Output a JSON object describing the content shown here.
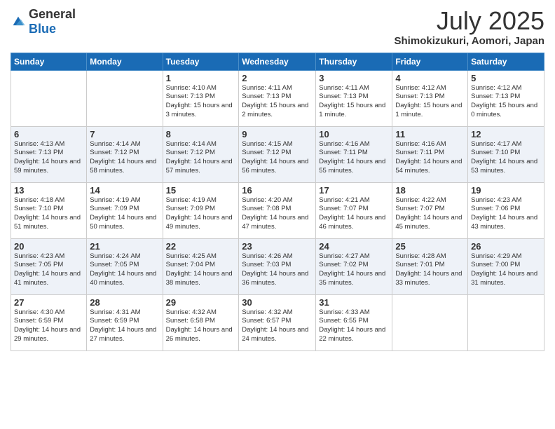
{
  "logo": {
    "general": "General",
    "blue": "Blue"
  },
  "title": "July 2025",
  "subtitle": "Shimokizukuri, Aomori, Japan",
  "weekdays": [
    "Sunday",
    "Monday",
    "Tuesday",
    "Wednesday",
    "Thursday",
    "Friday",
    "Saturday"
  ],
  "weeks": [
    [
      {
        "day": "",
        "sunrise": "",
        "sunset": "",
        "daylight": ""
      },
      {
        "day": "",
        "sunrise": "",
        "sunset": "",
        "daylight": ""
      },
      {
        "day": "1",
        "sunrise": "Sunrise: 4:10 AM",
        "sunset": "Sunset: 7:13 PM",
        "daylight": "Daylight: 15 hours and 3 minutes."
      },
      {
        "day": "2",
        "sunrise": "Sunrise: 4:11 AM",
        "sunset": "Sunset: 7:13 PM",
        "daylight": "Daylight: 15 hours and 2 minutes."
      },
      {
        "day": "3",
        "sunrise": "Sunrise: 4:11 AM",
        "sunset": "Sunset: 7:13 PM",
        "daylight": "Daylight: 15 hours and 1 minute."
      },
      {
        "day": "4",
        "sunrise": "Sunrise: 4:12 AM",
        "sunset": "Sunset: 7:13 PM",
        "daylight": "Daylight: 15 hours and 1 minute."
      },
      {
        "day": "5",
        "sunrise": "Sunrise: 4:12 AM",
        "sunset": "Sunset: 7:13 PM",
        "daylight": "Daylight: 15 hours and 0 minutes."
      }
    ],
    [
      {
        "day": "6",
        "sunrise": "Sunrise: 4:13 AM",
        "sunset": "Sunset: 7:13 PM",
        "daylight": "Daylight: 14 hours and 59 minutes."
      },
      {
        "day": "7",
        "sunrise": "Sunrise: 4:14 AM",
        "sunset": "Sunset: 7:12 PM",
        "daylight": "Daylight: 14 hours and 58 minutes."
      },
      {
        "day": "8",
        "sunrise": "Sunrise: 4:14 AM",
        "sunset": "Sunset: 7:12 PM",
        "daylight": "Daylight: 14 hours and 57 minutes."
      },
      {
        "day": "9",
        "sunrise": "Sunrise: 4:15 AM",
        "sunset": "Sunset: 7:12 PM",
        "daylight": "Daylight: 14 hours and 56 minutes."
      },
      {
        "day": "10",
        "sunrise": "Sunrise: 4:16 AM",
        "sunset": "Sunset: 7:11 PM",
        "daylight": "Daylight: 14 hours and 55 minutes."
      },
      {
        "day": "11",
        "sunrise": "Sunrise: 4:16 AM",
        "sunset": "Sunset: 7:11 PM",
        "daylight": "Daylight: 14 hours and 54 minutes."
      },
      {
        "day": "12",
        "sunrise": "Sunrise: 4:17 AM",
        "sunset": "Sunset: 7:10 PM",
        "daylight": "Daylight: 14 hours and 53 minutes."
      }
    ],
    [
      {
        "day": "13",
        "sunrise": "Sunrise: 4:18 AM",
        "sunset": "Sunset: 7:10 PM",
        "daylight": "Daylight: 14 hours and 51 minutes."
      },
      {
        "day": "14",
        "sunrise": "Sunrise: 4:19 AM",
        "sunset": "Sunset: 7:09 PM",
        "daylight": "Daylight: 14 hours and 50 minutes."
      },
      {
        "day": "15",
        "sunrise": "Sunrise: 4:19 AM",
        "sunset": "Sunset: 7:09 PM",
        "daylight": "Daylight: 14 hours and 49 minutes."
      },
      {
        "day": "16",
        "sunrise": "Sunrise: 4:20 AM",
        "sunset": "Sunset: 7:08 PM",
        "daylight": "Daylight: 14 hours and 47 minutes."
      },
      {
        "day": "17",
        "sunrise": "Sunrise: 4:21 AM",
        "sunset": "Sunset: 7:07 PM",
        "daylight": "Daylight: 14 hours and 46 minutes."
      },
      {
        "day": "18",
        "sunrise": "Sunrise: 4:22 AM",
        "sunset": "Sunset: 7:07 PM",
        "daylight": "Daylight: 14 hours and 45 minutes."
      },
      {
        "day": "19",
        "sunrise": "Sunrise: 4:23 AM",
        "sunset": "Sunset: 7:06 PM",
        "daylight": "Daylight: 14 hours and 43 minutes."
      }
    ],
    [
      {
        "day": "20",
        "sunrise": "Sunrise: 4:23 AM",
        "sunset": "Sunset: 7:05 PM",
        "daylight": "Daylight: 14 hours and 41 minutes."
      },
      {
        "day": "21",
        "sunrise": "Sunrise: 4:24 AM",
        "sunset": "Sunset: 7:05 PM",
        "daylight": "Daylight: 14 hours and 40 minutes."
      },
      {
        "day": "22",
        "sunrise": "Sunrise: 4:25 AM",
        "sunset": "Sunset: 7:04 PM",
        "daylight": "Daylight: 14 hours and 38 minutes."
      },
      {
        "day": "23",
        "sunrise": "Sunrise: 4:26 AM",
        "sunset": "Sunset: 7:03 PM",
        "daylight": "Daylight: 14 hours and 36 minutes."
      },
      {
        "day": "24",
        "sunrise": "Sunrise: 4:27 AM",
        "sunset": "Sunset: 7:02 PM",
        "daylight": "Daylight: 14 hours and 35 minutes."
      },
      {
        "day": "25",
        "sunrise": "Sunrise: 4:28 AM",
        "sunset": "Sunset: 7:01 PM",
        "daylight": "Daylight: 14 hours and 33 minutes."
      },
      {
        "day": "26",
        "sunrise": "Sunrise: 4:29 AM",
        "sunset": "Sunset: 7:00 PM",
        "daylight": "Daylight: 14 hours and 31 minutes."
      }
    ],
    [
      {
        "day": "27",
        "sunrise": "Sunrise: 4:30 AM",
        "sunset": "Sunset: 6:59 PM",
        "daylight": "Daylight: 14 hours and 29 minutes."
      },
      {
        "day": "28",
        "sunrise": "Sunrise: 4:31 AM",
        "sunset": "Sunset: 6:59 PM",
        "daylight": "Daylight: 14 hours and 27 minutes."
      },
      {
        "day": "29",
        "sunrise": "Sunrise: 4:32 AM",
        "sunset": "Sunset: 6:58 PM",
        "daylight": "Daylight: 14 hours and 26 minutes."
      },
      {
        "day": "30",
        "sunrise": "Sunrise: 4:32 AM",
        "sunset": "Sunset: 6:57 PM",
        "daylight": "Daylight: 14 hours and 24 minutes."
      },
      {
        "day": "31",
        "sunrise": "Sunrise: 4:33 AM",
        "sunset": "Sunset: 6:55 PM",
        "daylight": "Daylight: 14 hours and 22 minutes."
      },
      {
        "day": "",
        "sunrise": "",
        "sunset": "",
        "daylight": ""
      },
      {
        "day": "",
        "sunrise": "",
        "sunset": "",
        "daylight": ""
      }
    ]
  ]
}
